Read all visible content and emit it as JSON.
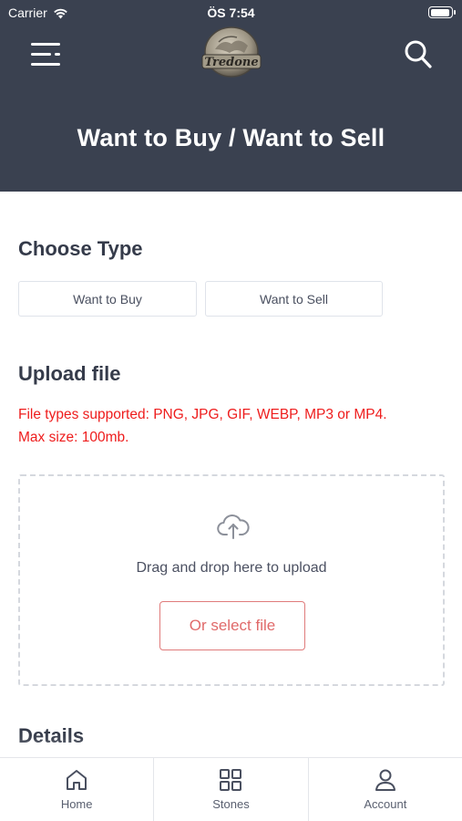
{
  "status_bar": {
    "carrier": "Carrier",
    "time": "ÖS 7:54"
  },
  "header": {
    "title": "Want to Buy / Want to Sell",
    "logo_text": "Tredone",
    "background_color": "#3a4150"
  },
  "choose_type": {
    "title": "Choose Type",
    "options": [
      "Want to Buy",
      "Want to Sell"
    ]
  },
  "upload": {
    "title": "Upload file",
    "note_line1": "File types supported: PNG, JPG, GIF, WEBP, MP3 or MP4.",
    "note_line2": "Max size: 100mb.",
    "note_color": "#ee1c1c",
    "drop_text": "Drag and drop here to upload",
    "select_label": "Or select file",
    "accent_color": "#e06a6a"
  },
  "details": {
    "title": "Details"
  },
  "bottom_nav": {
    "items": [
      {
        "label": "Home",
        "icon": "home-icon"
      },
      {
        "label": "Stones",
        "icon": "grid-icon"
      },
      {
        "label": "Account",
        "icon": "user-icon"
      }
    ]
  }
}
